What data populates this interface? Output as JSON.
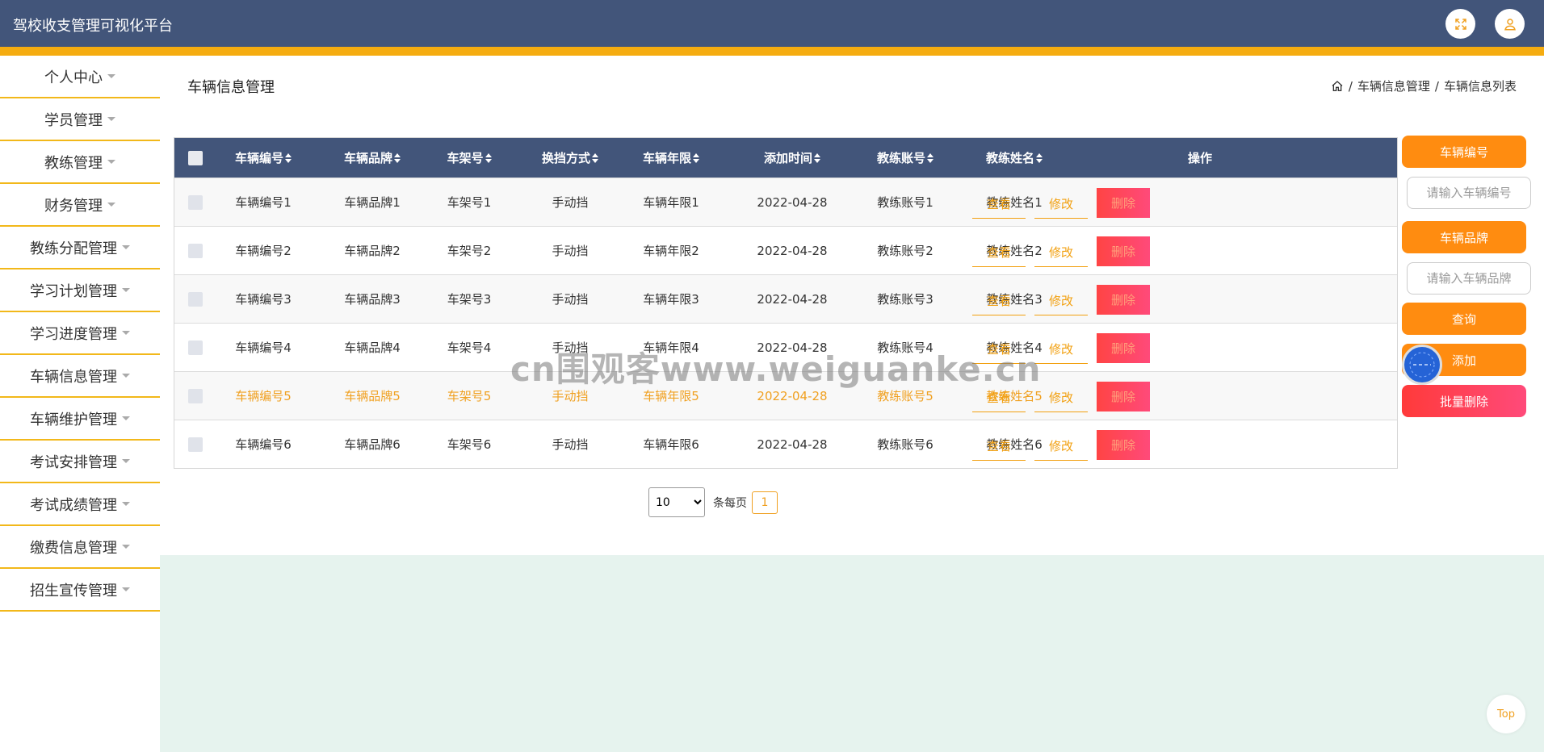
{
  "app": {
    "title": "驾校收支管理可视化平台"
  },
  "header": {
    "fullscreen_icon": "expand-icon",
    "user_icon": "user-icon"
  },
  "sidebar": {
    "items": [
      {
        "label": "个人中心"
      },
      {
        "label": "学员管理"
      },
      {
        "label": "教练管理"
      },
      {
        "label": "财务管理"
      },
      {
        "label": "教练分配管理"
      },
      {
        "label": "学习计划管理"
      },
      {
        "label": "学习进度管理"
      },
      {
        "label": "车辆信息管理"
      },
      {
        "label": "车辆维护管理"
      },
      {
        "label": "考试安排管理"
      },
      {
        "label": "考试成绩管理"
      },
      {
        "label": "缴费信息管理"
      },
      {
        "label": "招生宣传管理"
      }
    ]
  },
  "page": {
    "title": "车辆信息管理",
    "breadcrumb": [
      "车辆信息管理",
      "车辆信息列表"
    ],
    "breadcrumb_sep": "/"
  },
  "table": {
    "headers": [
      "车辆编号",
      "车辆品牌",
      "车架号",
      "换挡方式",
      "车辆年限",
      "添加时间",
      "教练账号",
      "教练姓名",
      "操作"
    ],
    "rows": [
      [
        "车辆编号1",
        "车辆品牌1",
        "车架号1",
        "手动挡",
        "车辆年限1",
        "2022-04-28",
        "教练账号1",
        "教练姓名1"
      ],
      [
        "车辆编号2",
        "车辆品牌2",
        "车架号2",
        "手动挡",
        "车辆年限2",
        "2022-04-28",
        "教练账号2",
        "教练姓名2"
      ],
      [
        "车辆编号3",
        "车辆品牌3",
        "车架号3",
        "手动挡",
        "车辆年限3",
        "2022-04-28",
        "教练账号3",
        "教练姓名3"
      ],
      [
        "车辆编号4",
        "车辆品牌4",
        "车架号4",
        "手动挡",
        "车辆年限4",
        "2022-04-28",
        "教练账号4",
        "教练姓名4"
      ],
      [
        "车辆编号5",
        "车辆品牌5",
        "车架号5",
        "手动挡",
        "车辆年限5",
        "2022-04-28",
        "教练账号5",
        "教练姓名5"
      ],
      [
        "车辆编号6",
        "车辆品牌6",
        "车架号6",
        "手动挡",
        "车辆年限6",
        "2022-04-28",
        "教练账号6",
        "教练姓名6"
      ]
    ],
    "actions": {
      "view": "查看",
      "edit": "修改",
      "delete": "删除"
    }
  },
  "pager": {
    "page_size": "10",
    "page_size_options": [
      "10"
    ],
    "per_page_label": "条每页",
    "current_page": "1"
  },
  "search_panel": {
    "field1_label": "车辆编号",
    "field1_placeholder": "请输入车辆编号",
    "field2_label": "车辆品牌",
    "field2_placeholder": "请输入车辆品牌",
    "query_label": "查询",
    "add_label": "添加",
    "batch_delete_label": "批量删除"
  },
  "watermark": "cn围观客www.weiguanke.cn",
  "top_button": "Top",
  "colors": {
    "header": "#42557a",
    "accent": "#f5ac10",
    "button": "#ff8c10",
    "danger": "#ff4444"
  }
}
